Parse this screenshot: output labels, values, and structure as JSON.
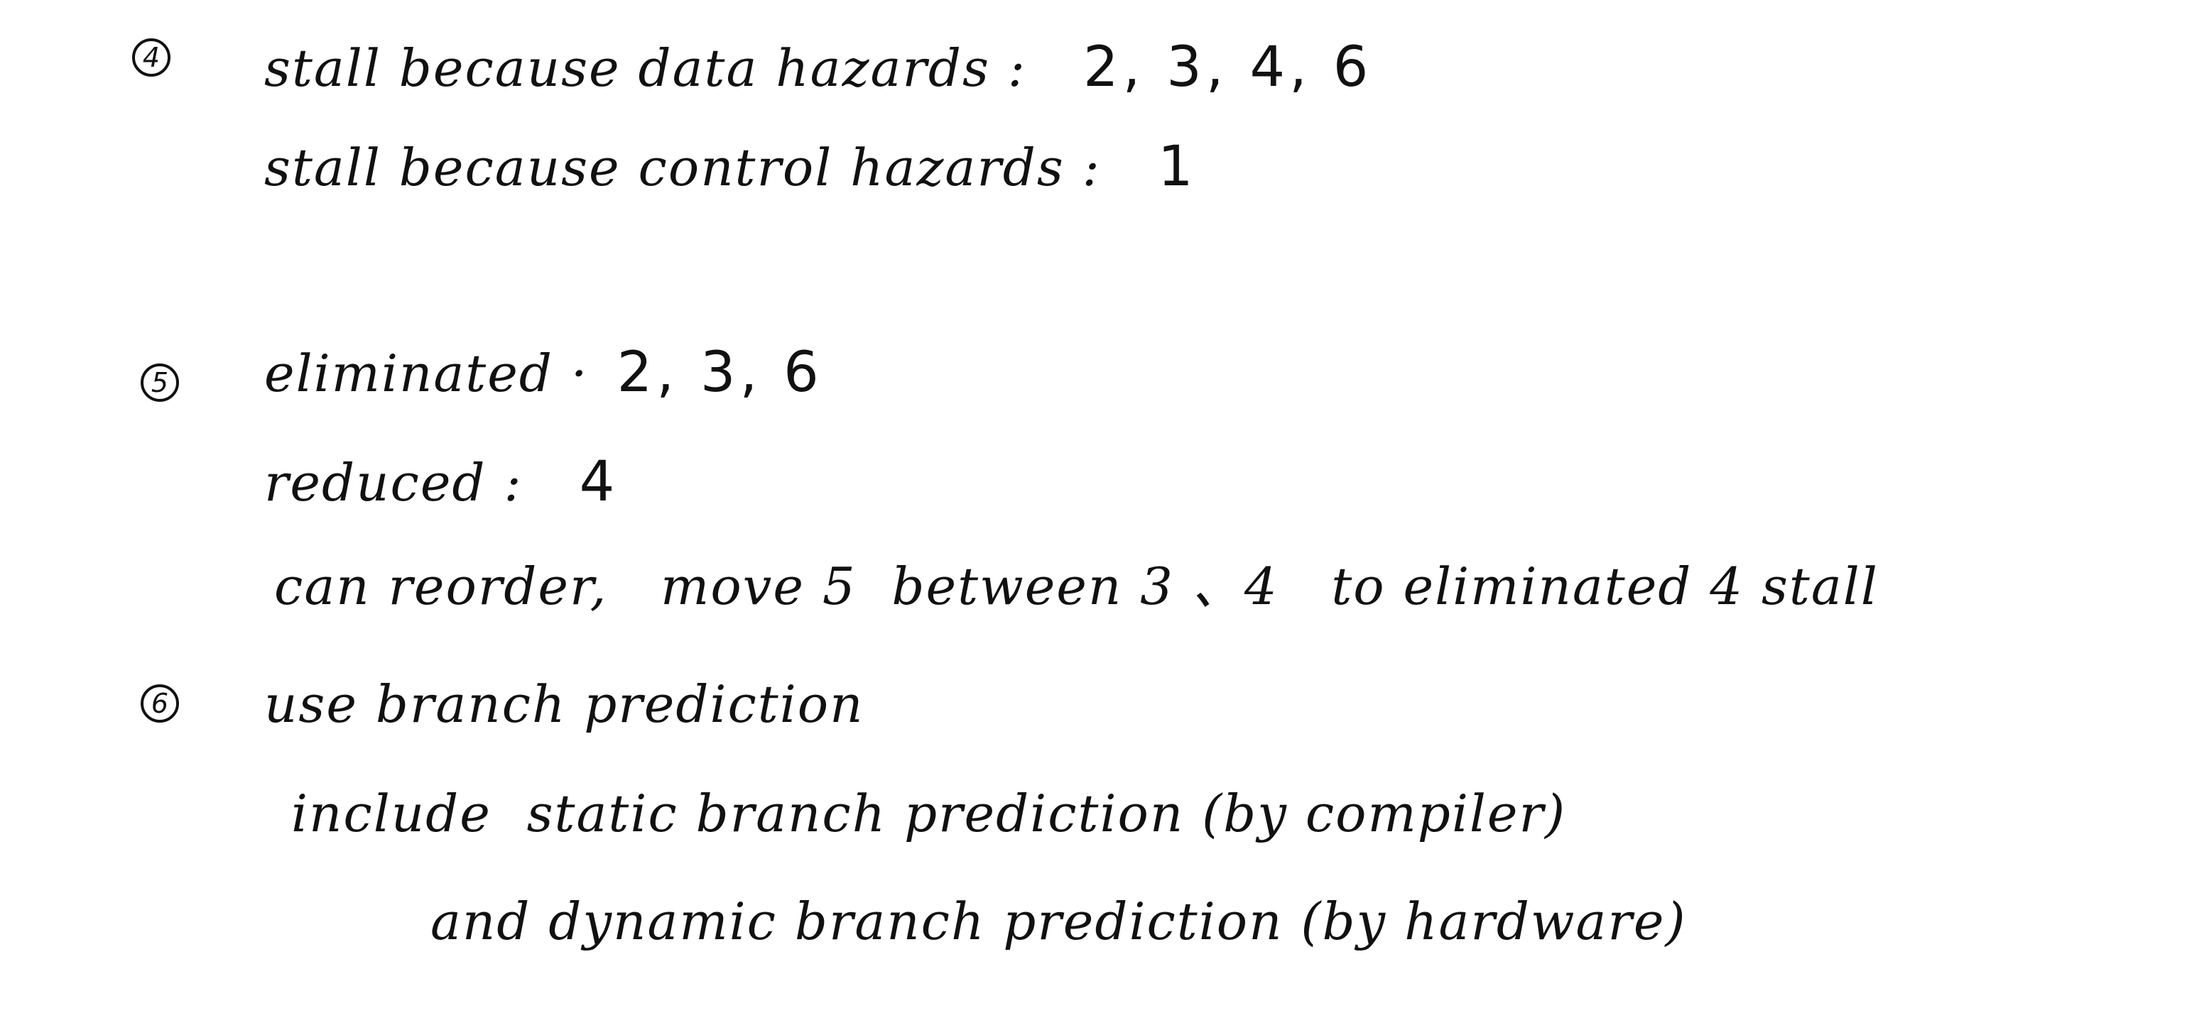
{
  "sections": [
    {
      "marker": "4",
      "lines": [
        {
          "label": "stall because data hazards :",
          "value": "2, 3, 4, 6"
        },
        {
          "label": "stall because control hazards :",
          "value": "1"
        }
      ]
    },
    {
      "marker": "5",
      "lines": [
        {
          "label": "eliminated ·",
          "value": "2, 3, 6"
        },
        {
          "label": "reduced :",
          "value": "4"
        },
        {
          "text": "can reorder,   move 5  between 3 、4   to eliminated 4 stall"
        }
      ]
    },
    {
      "marker": "6",
      "lines": [
        {
          "text": "use branch prediction"
        },
        {
          "text": "include  static branch prediction (by compiler)"
        },
        {
          "text": "and dynamic branch prediction (by hardware)"
        }
      ]
    }
  ]
}
